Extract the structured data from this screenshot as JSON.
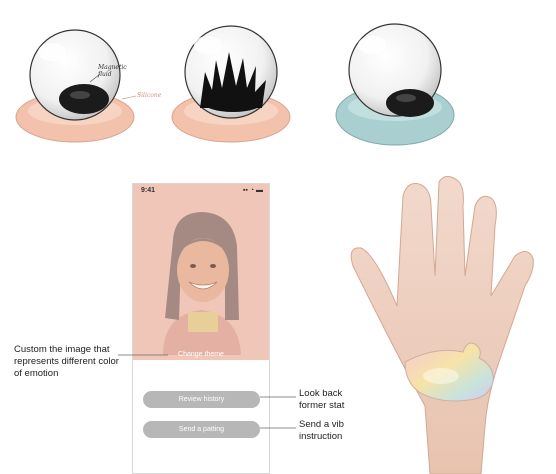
{
  "globes": {
    "annotation_fluid_line1": "Magnetic",
    "annotation_fluid_line2": "fluid",
    "annotation_silicone": "Silicone"
  },
  "phone": {
    "time": "9:41",
    "status_icons": "▪▪ ◔ ▬",
    "photo_caption": "Change theme",
    "review_button": "Review history",
    "send_button": "Send a patting"
  },
  "notes": {
    "custom_line1": "Custom the image that",
    "custom_line2": "represents different color",
    "custom_line3": "of emotion",
    "look_line1": "Look  back",
    "look_line2": "former stat",
    "send_line1": "Send a vib",
    "send_line2": "instruction"
  },
  "colors": {
    "pad_peach": "#f3c2ac",
    "pad_teal": "#a9cfd1",
    "button_gray": "#b7b7b7",
    "phone_tint": "#f0c6b8"
  }
}
